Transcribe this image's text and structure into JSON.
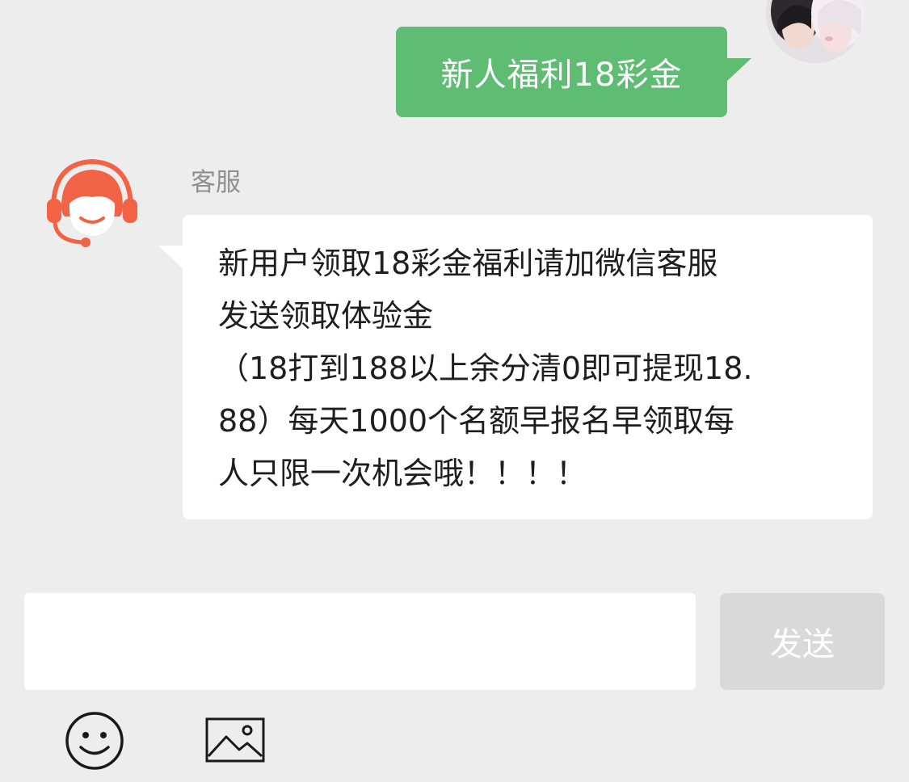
{
  "messages": {
    "outgoing": {
      "text": "新人福利18彩金",
      "bubble_color": "#5fbd73"
    },
    "incoming": {
      "sender": "客服",
      "lines": [
        "新用户领取18彩金福利请加微信客服",
        "发送领取体验金",
        "（18打到188以上余分清0即可提现18.",
        "88）每天1000个名额早报名早领取每",
        "人只限一次机会哦！！！！"
      ]
    }
  },
  "composer": {
    "input_value": "",
    "send_label": "发送"
  },
  "toolbar": {
    "icons": [
      "smiley-icon",
      "image-icon"
    ]
  },
  "colors": {
    "background": "#ededed",
    "service_accent": "#f26245",
    "send_disabled": "#d9d9d9"
  }
}
